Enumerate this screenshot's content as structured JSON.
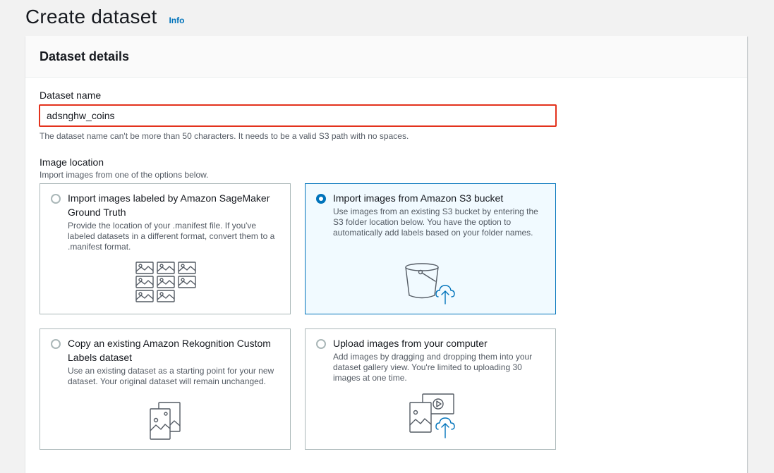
{
  "header": {
    "title": "Create dataset",
    "info_link": "Info"
  },
  "panel": {
    "title": "Dataset details",
    "dataset_name": {
      "label": "Dataset name",
      "value": "adsnghw_coins",
      "hint": "The dataset name can't be more than 50 characters. It needs to be a valid S3 path with no spaces."
    },
    "image_location": {
      "label": "Image location",
      "description": "Import images from one of the options below.",
      "options": [
        {
          "title": "Import images labeled by Amazon SageMaker Ground Truth",
          "description": "Provide the location of your .manifest file. If you've labeled datasets in a different format, convert them to a .manifest format.",
          "icon": "image-grid-icon",
          "selected": false
        },
        {
          "title": "Import images from Amazon S3 bucket",
          "description": "Use images from an existing S3 bucket by entering the S3 folder location below. You have the option to automatically add labels based on your folder names.",
          "icon": "s3-bucket-upload-icon",
          "selected": true
        },
        {
          "title": "Copy an existing Amazon Rekognition Custom Labels dataset",
          "description": "Use an existing dataset as a starting point for your new dataset. Your original dataset will remain unchanged.",
          "icon": "copy-dataset-icon",
          "selected": false
        },
        {
          "title": "Upload images from your computer",
          "description": "Add images by dragging and dropping them into your dataset gallery view. You're limited to uploading 30 images at one time.",
          "icon": "upload-media-icon",
          "selected": false
        }
      ]
    }
  },
  "colors": {
    "accent": "#0073bb",
    "error_border": "#e3321c",
    "selected_tile_bg": "#f1faff"
  }
}
